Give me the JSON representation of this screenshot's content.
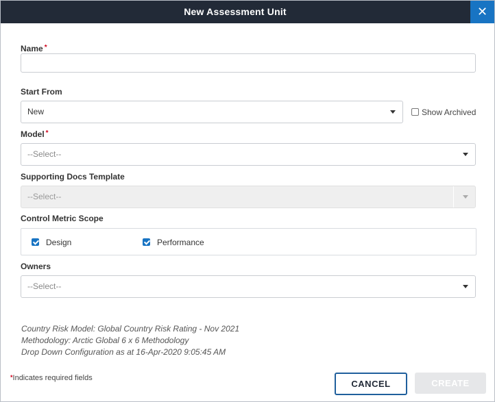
{
  "dialog": {
    "title": "New Assessment Unit",
    "close_symbol": "✕"
  },
  "form": {
    "name": {
      "label": "Name",
      "required_mark": "*",
      "value": "",
      "placeholder": ""
    },
    "start_from": {
      "label": "Start From",
      "value": "New",
      "show_archived": {
        "label": "Show Archived",
        "checked": false
      }
    },
    "model": {
      "label": "Model",
      "required_mark": "*",
      "value": "--Select--"
    },
    "supporting_docs_template": {
      "label": "Supporting Docs Template",
      "value": "--Select--",
      "disabled": true
    },
    "control_metric_scope": {
      "label": "Control Metric Scope",
      "options": [
        {
          "label": "Design",
          "checked": true
        },
        {
          "label": "Performance",
          "checked": true
        }
      ]
    },
    "owners": {
      "label": "Owners",
      "value": "--Select--"
    }
  },
  "info_lines": [
    "Country Risk Model: Global Country Risk Rating - Nov 2021",
    "Methodology: Arctic Global 6 x 6 Methodology",
    "Drop Down Configuration as at 16-Apr-2020 9:05:45 AM"
  ],
  "footer": {
    "required_mark": "*",
    "required_note": "Indicates required fields",
    "cancel_label": "CANCEL",
    "create_label": "CREATE"
  },
  "colors": {
    "titlebar": "#222a37",
    "close_button": "#1874c3",
    "required": "#d0021b",
    "checkbox_checked": "#1874c3",
    "create_disabled": "#e6e7e9"
  }
}
